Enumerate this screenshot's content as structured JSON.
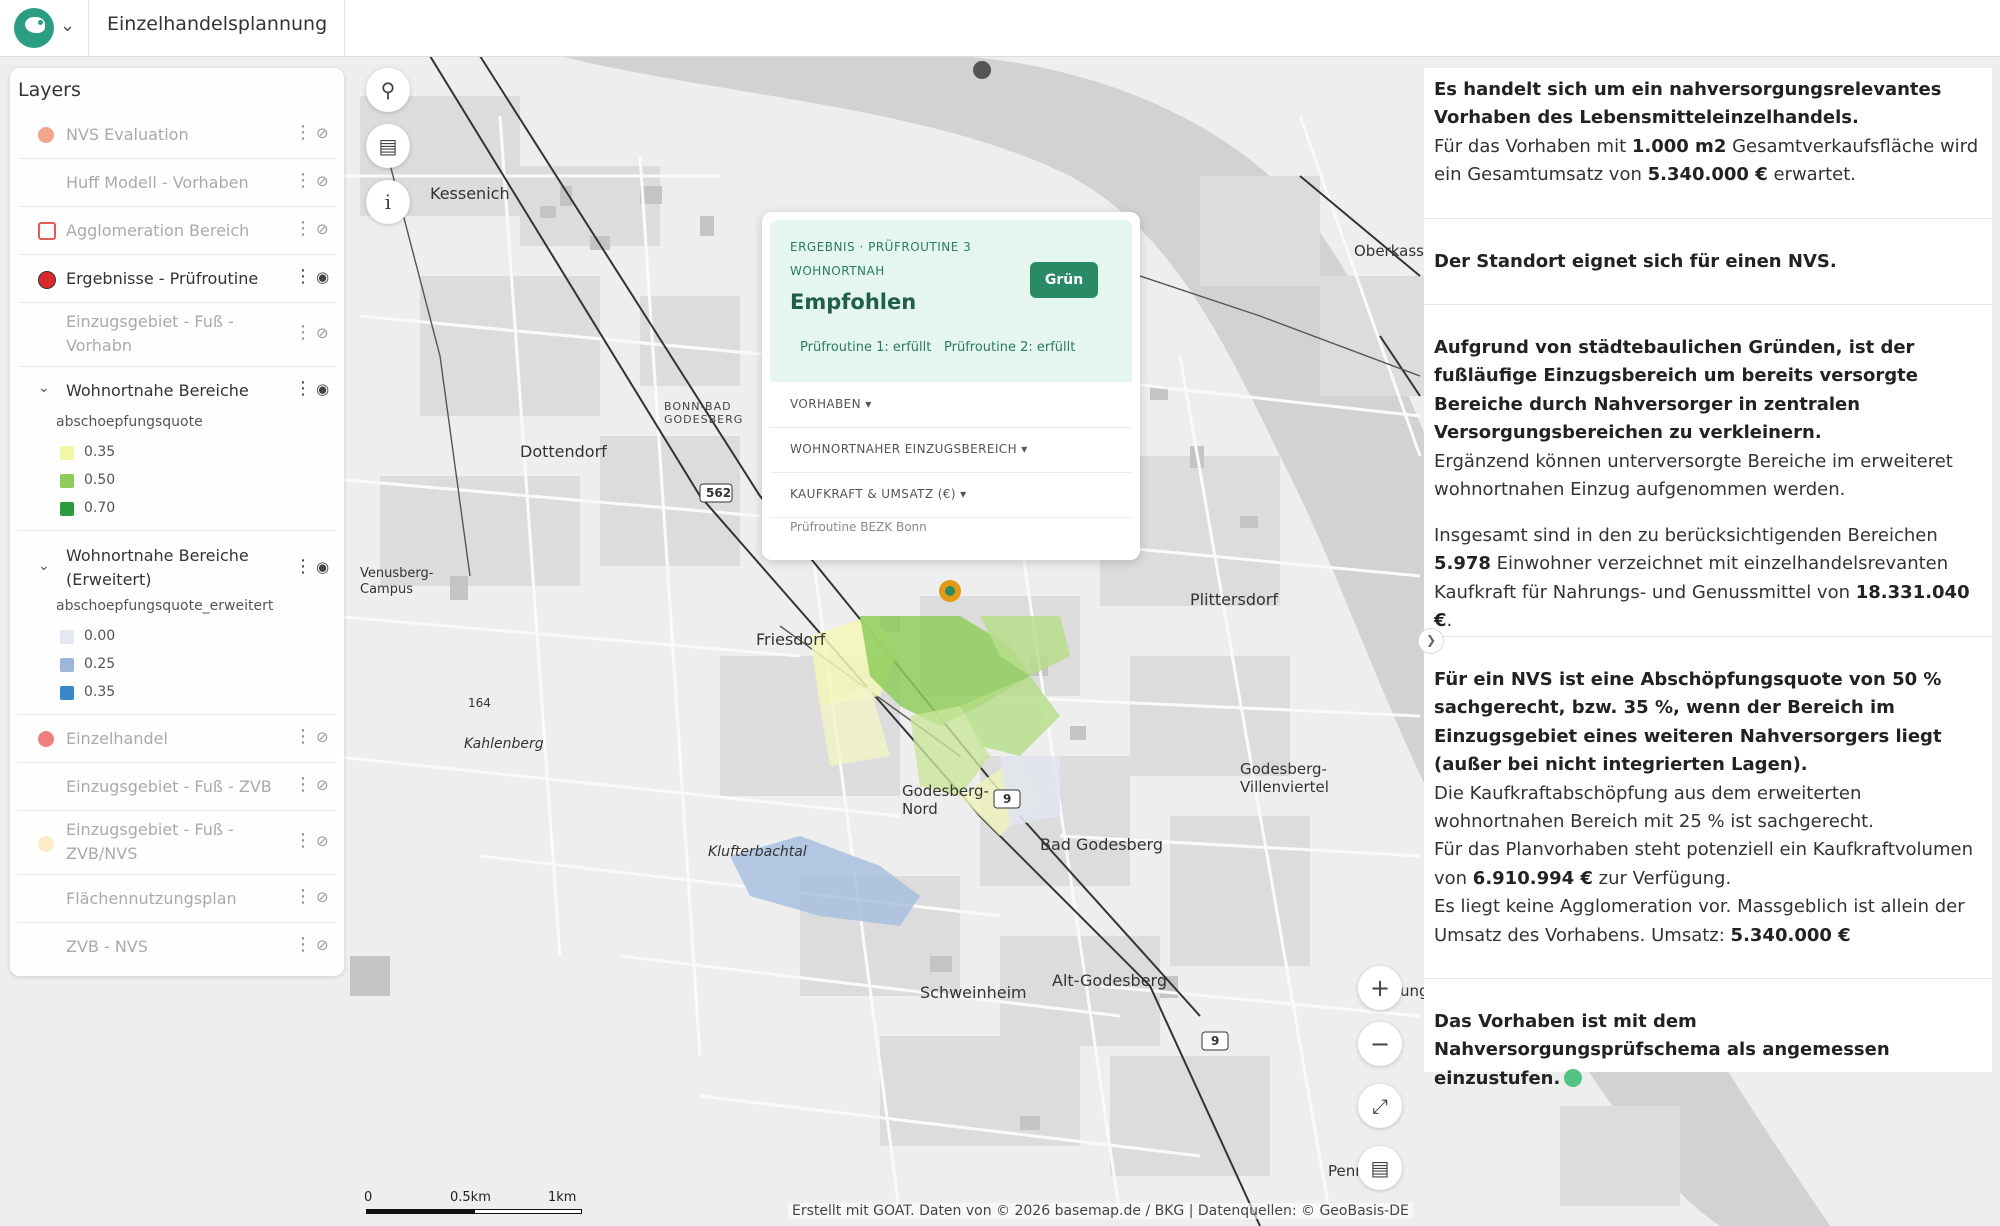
{
  "app": {
    "title": "Einzelhandelsplannung"
  },
  "layers": {
    "title": "Layers",
    "items": [
      {
        "name": "NVS Evaluation",
        "color": "#f2a58a"
      },
      {
        "name": "Huff Modell - Vorhaben"
      },
      {
        "name": "Agglomeration Bereich",
        "color": "#e05a5a"
      },
      {
        "name": "Ergebnisse - Prüfroutine",
        "color": "#d92b2b"
      },
      {
        "name": "Einzugsgebiet - Fuß -\nVorhabn"
      },
      {
        "name": "Wohnortnahe Bereiche"
      },
      {
        "name": "Wohnortnahe Bereiche\n(Erweitert)"
      },
      {
        "name": "Einzelhandel",
        "color": "#f08080"
      },
      {
        "name": "Einzugsgebiet - Fuß - ZVB"
      },
      {
        "name": "Einzugsgebiet - Fuß -\nZVB/NVS",
        "color": "#fbeec8"
      },
      {
        "name": "Flächennutzungsplan"
      },
      {
        "name": "ZVB - NVS"
      }
    ],
    "legend_1": {
      "field": "abschoepfungsquote",
      "classes": [
        {
          "value": "0.35",
          "color": "#f2f7a6"
        },
        {
          "value": "0.50",
          "color": "#8fcc5c"
        },
        {
          "value": "0.70",
          "color": "#2e9a3e"
        }
      ]
    },
    "legend_2": {
      "field": "abschoepfungsquote_erweitert",
      "classes": [
        {
          "value": "0.00",
          "color": "#e3e8f2"
        },
        {
          "value": "0.25",
          "color": "#9fb6d9"
        },
        {
          "value": "0.35",
          "color": "#3a87c7"
        }
      ]
    }
  },
  "popup": {
    "kicker_1": "ERGEBNIS · PRÜFROUTINE 3",
    "kicker_2": "WOHNORTNAH",
    "title": "Empfohlen",
    "badge": "Grün",
    "check_1": "Prüfroutine 1: erfüllt",
    "check_2": "Prüfroutine 2: erfüllt",
    "row_1": "VORHABEN",
    "row_2": "WOHNORTNAHER EINZUGSBEREICH",
    "row_3": "KAUFKRAFT & UMSATZ (€)",
    "footer": "Prüfroutine BEZK Bonn"
  },
  "report": {
    "p1_line1": "Es handelt sich um ein nahversorgungsrelevantes Vorhaben des Lebensmitteleinzelhandels.",
    "p1_a": "Für das Vorhaben mit ",
    "p1_area": "1.000 m2",
    "p1_b": " Gesamtverkaufsfläche wird ein Gesamtumsatz von ",
    "p1_turnover": "5.340.000 €",
    "p1_c": " erwartet.",
    "p2": "Der Standort eignet sich für einen NVS.",
    "p3_bold": "Aufgrund von städtebaulichen Gründen, ist der fußläufige Einzugsbereich um bereits versorgte Bereiche durch Nahversorger in zentralen Versorgungsbereichen zu verkleinern.",
    "p3_rest": "Ergänzend können unterversorgte Bereiche im erweiteret wohnortnahen Einzug aufgenommen werden.",
    "p4_a": "Insgesamt sind in den zu berücksichtigenden Bereichen ",
    "p4_pop": "5.978",
    "p4_b": " Einwohner verzeichnet mit einzelhandelsrevanten Kaufkraft für Nahrungs- und Genussmittel von ",
    "p4_power": "18.331.040 €",
    "p4_c": ".",
    "p5_bold": "Für ein NVS ist eine Abschöpfungsquote von 50 % sachgerecht, bzw. 35 %, wenn der Bereich im Einzugsgebiet eines weiteren Nahversorgers liegt (außer bei nicht integrierten Lagen).",
    "p5_line2": "Die Kaufkraftabschöpfung aus dem erweiterten wohnortnahen Bereich mit 25 % ist sachgerecht.",
    "p5_c": "Für das Planvorhaben steht potenziell ein Kaufkraftvolumen von ",
    "p5_volume": "6.910.994 €",
    "p5_d": " zur Verfügung.",
    "p5_e": "Es liegt keine Agglomeration vor. Massgeblich ist allein der Umsatz des Vorhabens. Umsatz: ",
    "p5_turnover": "5.340.000 €",
    "p6": "Das Vorhaben ist mit dem Nahversorgungsprüfschema als angemessen einzustufen."
  },
  "map_labels": {
    "kessenich": "Kessenich",
    "dottendorf": "Dottendorf",
    "friesdorf": "Friesdorf",
    "plittersdorf": "Plittersdorf",
    "venusberg": "Venusberg-\nCampus",
    "kahlenberg": "Kahlenberg",
    "godesberg_nord": "Godesberg-\nNord",
    "bad_godesberg": "Bad Godesberg",
    "villenviertel": "Godesberg-\nVillenviertel",
    "klufterbachtal": "Klufterbachtal",
    "schweinheim": "Schweinheim",
    "alt_godesberg": "Alt-Godesberg",
    "oberkassel": "Oberkasse",
    "bonn_bad": "BONN-BAD\nGODESBERG",
    "road_562": "562",
    "road_9": "9",
    "elev_164": "164",
    "pennef": "Penne",
    "ung": "ung"
  },
  "scale": {
    "s0": "0",
    "s1": "0.5km",
    "s2": "1km"
  },
  "attribution": "Erstellt mit GOAT. Daten von © 2026 basemap.de / BKG | Datenquellen: © GeoBasis-DE"
}
